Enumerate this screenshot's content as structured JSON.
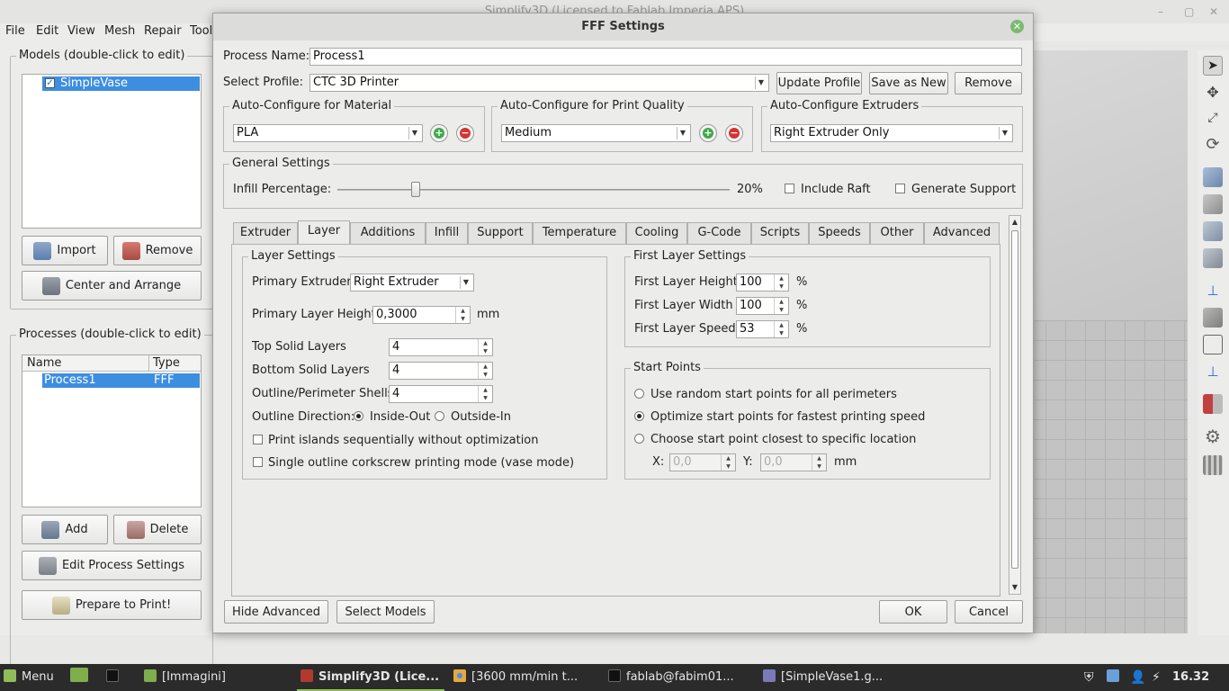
{
  "app": {
    "title": "Simplify3D (Licensed to Fablab Imperia APS)",
    "window_controls": [
      "–",
      "▢",
      "✕"
    ],
    "menu": [
      "File",
      "Edit",
      "View",
      "Mesh",
      "Repair",
      "Tool"
    ]
  },
  "left_panel": {
    "models_title": "Models (double-click to edit)",
    "models": [
      {
        "name": "SimpleVase",
        "checked": true
      }
    ],
    "import_label": "Import",
    "remove_label": "Remove",
    "center_arrange_label": "Center and Arrange",
    "processes_title": "Processes (double-click to edit)",
    "process_columns": [
      "Name",
      "Type"
    ],
    "processes": [
      {
        "name": "Process1",
        "type": "FFF"
      }
    ],
    "add_label": "Add",
    "delete_label": "Delete",
    "edit_process_label": "Edit Process Settings",
    "prepare_label": "Prepare to Print!"
  },
  "dialog": {
    "title": "FFF Settings",
    "process_name_label": "Process Name:",
    "process_name_value": "Process1",
    "select_profile_label": "Select Profile:",
    "select_profile_value": "CTC 3D Printer",
    "update_profile_label": "Update Profile",
    "save_as_new_label": "Save as New",
    "remove_label": "Remove",
    "material_group": "Auto-Configure for Material",
    "material_value": "PLA",
    "quality_group": "Auto-Configure for Print Quality",
    "quality_value": "Medium",
    "extruders_group": "Auto-Configure Extruders",
    "extruders_value": "Right Extruder Only",
    "general_group": "General Settings",
    "infill_label": "Infill Percentage:",
    "infill_value_text": "20%",
    "infill_fraction": 0.2,
    "include_raft_label": "Include Raft",
    "generate_support_label": "Generate Support",
    "tabs": [
      "Extruder",
      "Layer",
      "Additions",
      "Infill",
      "Support",
      "Temperature",
      "Cooling",
      "G-Code",
      "Scripts",
      "Speeds",
      "Other",
      "Advanced"
    ],
    "active_tab": "Layer",
    "layer": {
      "group_title": "Layer Settings",
      "primary_extruder_label": "Primary Extruder",
      "primary_extruder_value": "Right Extruder",
      "primary_layer_height_label": "Primary Layer Height",
      "primary_layer_height_value": "0,3000",
      "primary_layer_height_unit": "mm",
      "top_solid_label": "Top Solid Layers",
      "top_solid_value": "4",
      "bottom_solid_label": "Bottom Solid Layers",
      "bottom_solid_value": "4",
      "outline_shells_label": "Outline/Perimeter Shells",
      "outline_shells_value": "4",
      "outline_direction_label": "Outline Direction:",
      "inside_out_label": "Inside-Out",
      "outside_in_label": "Outside-In",
      "print_islands_label": "Print islands sequentially without optimization",
      "single_outline_label": "Single outline corkscrew printing mode (vase mode)"
    },
    "first_layer": {
      "group_title": "First Layer Settings",
      "height_label": "First Layer Height",
      "height_value": "100",
      "width_label": "First Layer Width",
      "width_value": "100",
      "speed_label": "First Layer Speed",
      "speed_value": "53",
      "unit": "%"
    },
    "start_points": {
      "group_title": "Start Points",
      "option_random": "Use random start points for all perimeters",
      "option_optimize": "Optimize start points for fastest printing speed",
      "option_closest": "Choose start point closest to specific location",
      "x_label": "X:",
      "x_value": "0,0",
      "y_label": "Y:",
      "y_value": "0,0",
      "unit": "mm"
    },
    "hide_advanced_label": "Hide Advanced",
    "select_models_label": "Select Models",
    "ok_label": "OK",
    "cancel_label": "Cancel"
  },
  "taskbar": {
    "menu_label": "Menu",
    "tasks": [
      "[Immagini]",
      "Simplify3D (Lice...",
      "[3600 mm/min t...",
      "fablab@fabim01...",
      "[SimpleVase1.g..."
    ],
    "clock": "16.32"
  }
}
